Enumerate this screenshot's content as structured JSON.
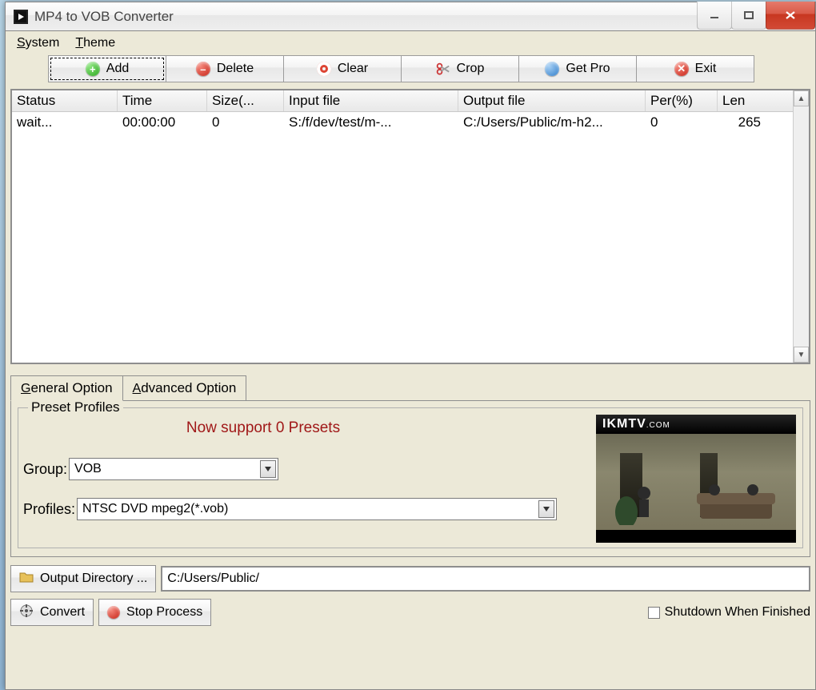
{
  "window": {
    "title": "MP4 to VOB Converter"
  },
  "menubar": {
    "system": "System",
    "theme": "Theme"
  },
  "toolbar": {
    "add": "Add",
    "delete": "Delete",
    "clear": "Clear",
    "crop": "Crop",
    "getpro": "Get Pro",
    "exit": "Exit"
  },
  "table": {
    "headers": {
      "status": "Status",
      "time": "Time",
      "size": "Size(...",
      "input": "Input file",
      "output": "Output file",
      "per": "Per(%)",
      "len": "Len"
    },
    "rows": [
      {
        "status": "wait...",
        "time": "00:00:00",
        "size": "0",
        "input": "S:/f/dev/test/m-...",
        "output": "C:/Users/Public/m-h2...",
        "per": "0",
        "len": "265"
      }
    ]
  },
  "tabs": {
    "general": "General Option",
    "advanced": "Advanced Option"
  },
  "preset": {
    "legend": "Preset Profiles",
    "message": "Now support 0 Presets",
    "group_label": "Group:",
    "group_value": "VOB",
    "profiles_label": "Profiles:",
    "profiles_value": "NTSC DVD mpeg2(*.vob)"
  },
  "preview": {
    "brand": "IKMTV",
    "brand_suffix": ".COM"
  },
  "output": {
    "button": "Output Directory ...",
    "path": "C:/Users/Public/"
  },
  "actions": {
    "convert": "Convert",
    "stop": "Stop Process",
    "shutdown": "Shutdown When Finished"
  }
}
